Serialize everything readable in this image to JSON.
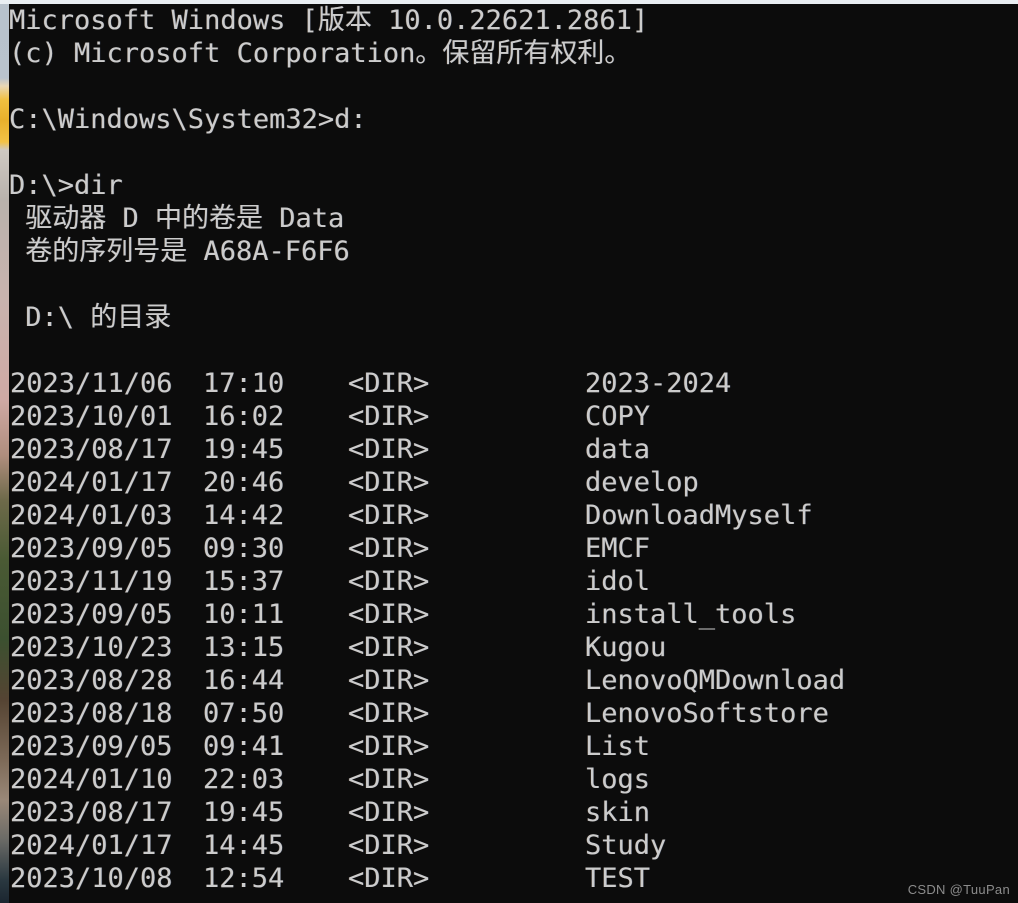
{
  "window": {
    "app_name": "Command Prompt",
    "background_color": "#0c0c0c",
    "foreground_color": "#cccccc"
  },
  "console": {
    "banner": [
      "Microsoft Windows [版本 10.0.22621.2861]",
      "(c) Microsoft Corporation。保留所有权利。"
    ],
    "prompt_line_1": "C:\\Windows\\System32>d:",
    "prompt_line_2": "D:\\>dir",
    "volume_label_line": " 驱动器 D 中的卷是 Data",
    "volume_serial_line": " 卷的序列号是 A68A-F6F6",
    "directory_of_line": " D:\\ 的目录",
    "dir_marker": "<DIR>",
    "entries": [
      {
        "date": "2023/11/06",
        "time": "17:10",
        "type": "<DIR>",
        "name": "2023-2024"
      },
      {
        "date": "2023/10/01",
        "time": "16:02",
        "type": "<DIR>",
        "name": "COPY"
      },
      {
        "date": "2023/08/17",
        "time": "19:45",
        "type": "<DIR>",
        "name": "data"
      },
      {
        "date": "2024/01/17",
        "time": "20:46",
        "type": "<DIR>",
        "name": "develop"
      },
      {
        "date": "2024/01/03",
        "time": "14:42",
        "type": "<DIR>",
        "name": "DownloadMyself"
      },
      {
        "date": "2023/09/05",
        "time": "09:30",
        "type": "<DIR>",
        "name": "EMCF"
      },
      {
        "date": "2023/11/19",
        "time": "15:37",
        "type": "<DIR>",
        "name": "idol"
      },
      {
        "date": "2023/09/05",
        "time": "10:11",
        "type": "<DIR>",
        "name": "install_tools"
      },
      {
        "date": "2023/10/23",
        "time": "13:15",
        "type": "<DIR>",
        "name": "Kugou"
      },
      {
        "date": "2023/08/28",
        "time": "16:44",
        "type": "<DIR>",
        "name": "LenovoQMDownload"
      },
      {
        "date": "2023/08/18",
        "time": "07:50",
        "type": "<DIR>",
        "name": "LenovoSoftstore"
      },
      {
        "date": "2023/09/05",
        "time": "09:41",
        "type": "<DIR>",
        "name": "List"
      },
      {
        "date": "2024/01/10",
        "time": "22:03",
        "type": "<DIR>",
        "name": "logs"
      },
      {
        "date": "2023/08/17",
        "time": "19:45",
        "type": "<DIR>",
        "name": "skin"
      },
      {
        "date": "2024/01/17",
        "time": "14:45",
        "type": "<DIR>",
        "name": "Study"
      },
      {
        "date": "2023/10/08",
        "time": "12:54",
        "type": "<DIR>",
        "name": "TEST"
      }
    ]
  },
  "watermark": {
    "text": "CSDN @TuuPan"
  }
}
